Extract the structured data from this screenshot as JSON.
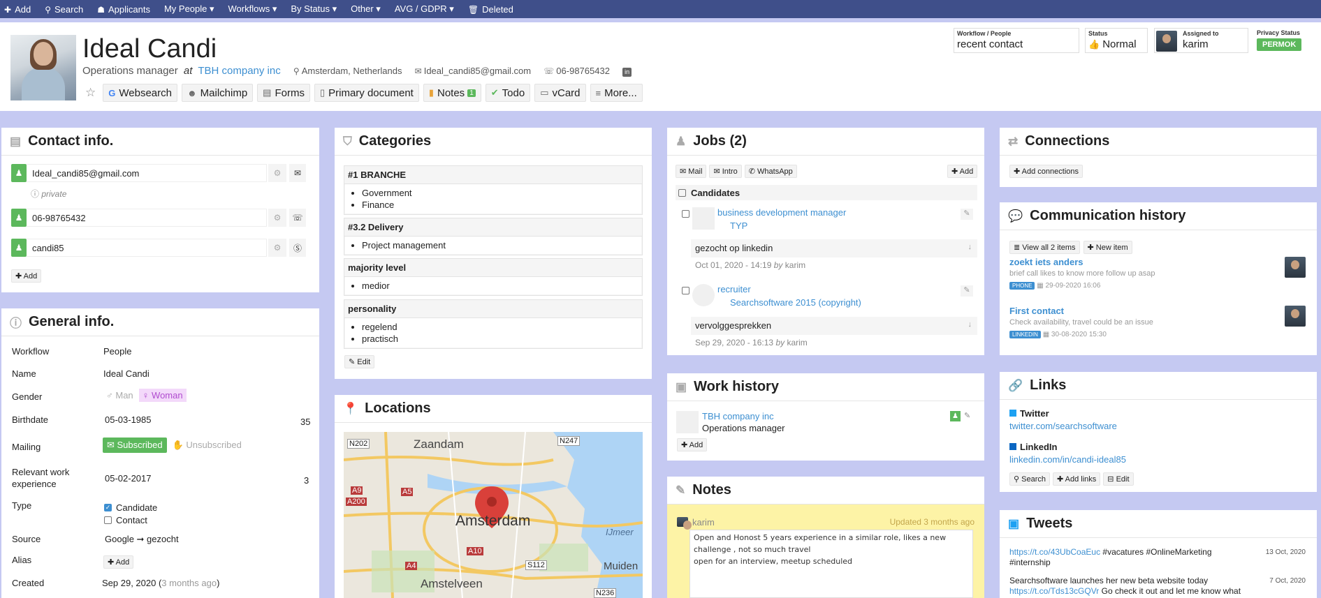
{
  "topnav": [
    {
      "icon": "+",
      "label": "Add"
    },
    {
      "icon": "⚲",
      "label": "Search"
    },
    {
      "icon": "👥",
      "label": "Applicants"
    },
    {
      "icon": "",
      "label": "My People ▾"
    },
    {
      "icon": "",
      "label": "Workflows ▾"
    },
    {
      "icon": "",
      "label": "By Status ▾"
    },
    {
      "icon": "",
      "label": "Other ▾"
    },
    {
      "icon": "",
      "label": "AVG / GDPR ▾"
    },
    {
      "icon": "🗑",
      "label": "Deleted"
    }
  ],
  "candidate": {
    "name": "Ideal Candi",
    "job_title": "Operations manager",
    "at": "at",
    "company": "TBH company inc",
    "location": "Amsterdam, Netherlands",
    "email": "Ideal_candi85@gmail.com",
    "phone": "06-98765432"
  },
  "header_actions": [
    {
      "icon": "G",
      "label": "Websearch"
    },
    {
      "icon": "☻",
      "label": "Mailchimp"
    },
    {
      "icon": "▤",
      "label": "Forms"
    },
    {
      "icon": "▯",
      "label": "Primary document"
    },
    {
      "icon": "▮",
      "label": "Notes",
      "badge": "1"
    },
    {
      "icon": "✔",
      "label": "Todo"
    },
    {
      "icon": "▭",
      "label": "vCard"
    },
    {
      "icon": "≡",
      "label": "More..."
    }
  ],
  "status_boxes": {
    "workflow_label": "Workflow / People",
    "workflow_value": "recent contact",
    "status_label": "Status",
    "status_value": "Normal",
    "assigned_label": "Assigned to",
    "assigned_value": "karim",
    "privacy_label": "Privacy Status",
    "privacy_value": "PERMOK"
  },
  "contact_info": {
    "title": "Contact info.",
    "email": "Ideal_candi85@gmail.com",
    "email_note": "private",
    "phone": "06-98765432",
    "skype": "candi85",
    "add_label": "Add"
  },
  "general_info": {
    "title": "General info.",
    "rows": {
      "workflow": {
        "label": "Workflow",
        "value": "People"
      },
      "name": {
        "label": "Name",
        "value": "Ideal Candi"
      },
      "gender": {
        "label": "Gender",
        "opt1": "Man",
        "opt2": "Woman"
      },
      "birthdate": {
        "label": "Birthdate",
        "value": "05-03-1985",
        "extra": "35"
      },
      "mailing": {
        "label": "Mailing",
        "opt1": "Subscribed",
        "opt2": "Unsubscribed"
      },
      "relevant": {
        "label": "Relevant work experience",
        "value": "05-02-2017",
        "extra": "3"
      },
      "type": {
        "label": "Type",
        "opt1": "Candidate",
        "opt2": "Contact"
      },
      "source": {
        "label": "Source",
        "value": "Google ➞ gezocht"
      },
      "alias": {
        "label": "Alias",
        "add": "Add"
      },
      "created": {
        "label": "Created",
        "value": "Sep 29, 2020 (",
        "ago": "3 months ago",
        "close": ")"
      }
    }
  },
  "categories": {
    "title": "Categories",
    "blocks": [
      {
        "title": "#1 BRANCHE",
        "items": [
          "Government",
          "Finance"
        ]
      },
      {
        "title": "#3.2 Delivery",
        "items": [
          "Project management"
        ]
      },
      {
        "title": "majority level",
        "items": [
          "medior"
        ]
      },
      {
        "title": "personality",
        "items": [
          "regelend",
          "practisch"
        ]
      }
    ],
    "edit_label": "Edit"
  },
  "locations": {
    "title": "Locations",
    "map_labels": [
      "Zaandam",
      "Amsterdam",
      "Amstelveen",
      "IJmeer",
      "Muiden",
      "N202",
      "N247",
      "A9",
      "A5",
      "A200",
      "A10",
      "A4",
      "S112",
      "N236"
    ]
  },
  "jobs": {
    "title": "Jobs (2)",
    "buttons": [
      "Mail",
      "Intro",
      "WhatsApp"
    ],
    "add_label": "Add",
    "candidates_label": "Candidates",
    "items": [
      {
        "title": "business development manager",
        "company": "TYP",
        "note": "gezocht op linkedin",
        "date": "Oct 01, 2020 - 14:19",
        "by": "by",
        "author": "karim"
      },
      {
        "title": "recruiter",
        "company": "Searchsoftware 2015 (copyright)",
        "note": "vervolggesprekken",
        "date": "Sep 29, 2020 - 16:13",
        "by": "by",
        "author": "karim"
      }
    ]
  },
  "work_history": {
    "title": "Work history",
    "company": "TBH company inc",
    "role": "Operations manager",
    "add_label": "Add"
  },
  "notes": {
    "title": "Notes",
    "author": "karim",
    "updated": "Updated 3 months ago",
    "line1": "Open and Honost 5 years  experience in a similar role, likes a new",
    "line2": "challenge , not so much travel",
    "line3": "open for an interview, meetup scheduled"
  },
  "connections": {
    "title": "Connections",
    "add_label": "Add connections"
  },
  "communication": {
    "title": "Communication history",
    "view_all": "View all 2 items",
    "new_item": "New item",
    "items": [
      {
        "title": "zoekt iets anders",
        "desc": "brief call likes to know more follow up asap",
        "tag": "PHONE",
        "date": "29-09-2020 16:06"
      },
      {
        "title": "First contact",
        "desc": "Check availability, travel could be an issue",
        "tag": "LINKEDIN",
        "date": "30-08-2020 15:30"
      }
    ]
  },
  "links": {
    "title": "Links",
    "items": [
      {
        "name": "Twitter",
        "url": "twitter.com/searchsoftware"
      },
      {
        "name": "LinkedIn",
        "url": "linkedin.com/in/candi-ideal85"
      }
    ],
    "search": "Search",
    "add": "Add links",
    "edit": "Edit"
  },
  "tweets": {
    "title": "Tweets",
    "items": [
      {
        "link": "https://t.co/43UbCoaEuc",
        "text": " #vacatures #OnlineMarketing",
        "text2": "#internship",
        "date": "13 Oct, 2020"
      },
      {
        "pre": "Searchsoftware launches her new beta website today",
        "link": "https://t.co/Tds13cGQVr",
        "text": " Go check it out and let me know what",
        "date": "7 Oct, 2020"
      }
    ]
  },
  "colors": {
    "nav": "#3f4f8a",
    "bg": "#c5c9f2",
    "green": "#5cb85c",
    "link": "#3d8fd1",
    "note_yellow": "#fdf3a6"
  }
}
